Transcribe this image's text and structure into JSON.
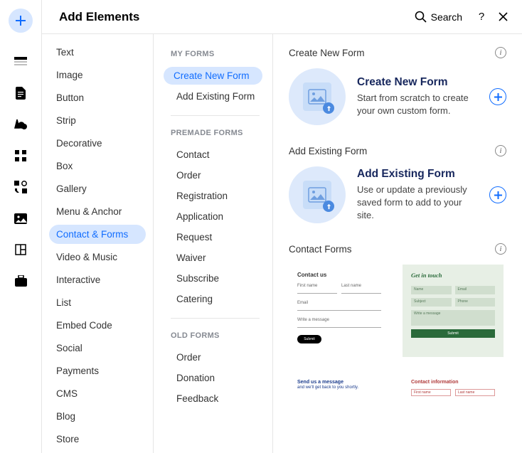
{
  "header": {
    "title": "Add Elements",
    "search_label": "Search"
  },
  "rail_icons": [
    "plus",
    "section",
    "page",
    "font",
    "apps",
    "integrations",
    "image",
    "layout",
    "briefcase"
  ],
  "categories": [
    "Text",
    "Image",
    "Button",
    "Strip",
    "Decorative",
    "Box",
    "Gallery",
    "Menu & Anchor",
    "Contact & Forms",
    "Video & Music",
    "Interactive",
    "List",
    "Embed Code",
    "Social",
    "Payments",
    "CMS",
    "Blog",
    "Store"
  ],
  "categories_active_index": 8,
  "groups": [
    {
      "label": "MY FORMS",
      "items": [
        "Create New Form",
        "Add Existing Form"
      ],
      "active_index": 0
    },
    {
      "label": "PREMADE FORMS",
      "items": [
        "Contact",
        "Order",
        "Registration",
        "Application",
        "Request",
        "Waiver",
        "Subscribe",
        "Catering"
      ]
    },
    {
      "label": "OLD FORMS",
      "items": [
        "Order",
        "Donation",
        "Feedback"
      ]
    }
  ],
  "content": {
    "sections": [
      {
        "heading": "Create New Form",
        "option": {
          "title": "Create New Form",
          "desc": "Start from scratch to create your own custom form."
        }
      },
      {
        "heading": "Add Existing Form",
        "option": {
          "title": "Add Existing Form",
          "desc": "Use or update a previously saved form to add to your site."
        }
      },
      {
        "heading": "Contact Forms",
        "templates": [
          {
            "kind": "light",
            "title": "Contact us",
            "fields_row": [
              "First name",
              "Last name"
            ],
            "field_single1": "Email",
            "field_single2": "Write a message",
            "button": "Submit"
          },
          {
            "kind": "green",
            "title": "Get in touch",
            "row1": [
              "Name",
              "Email"
            ],
            "row2": [
              "Subject",
              "Phone"
            ],
            "area": "Write a message",
            "button": "Submit"
          },
          {
            "kind": "blue-text",
            "line1": "Send us a message",
            "line2": "and we'll get back to you shortly."
          },
          {
            "kind": "red-text",
            "title": "Contact information",
            "fields": [
              "First name",
              "Last name"
            ]
          }
        ]
      }
    ]
  }
}
